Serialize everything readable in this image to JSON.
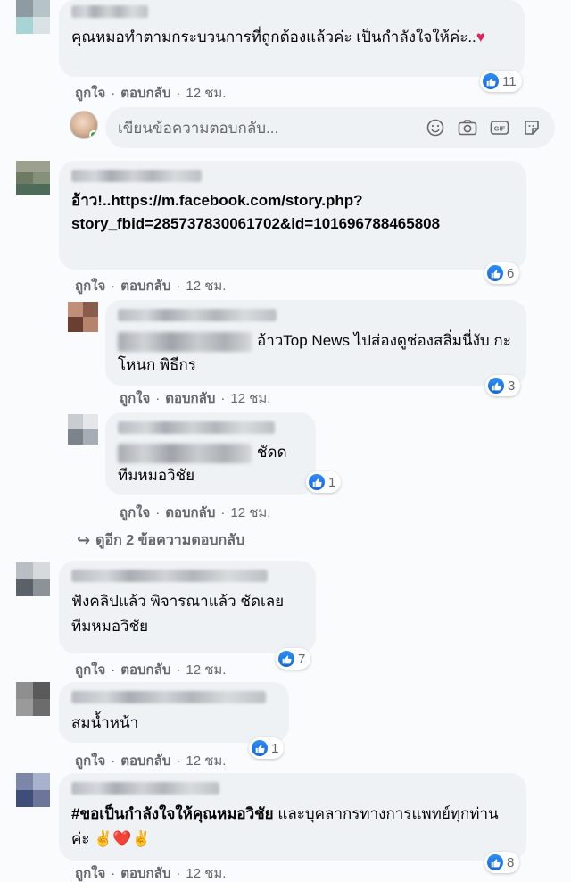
{
  "actions": {
    "like": "ถูกใจ",
    "reply": "ตอบกลับ",
    "separator": "·"
  },
  "reply_input": {
    "placeholder": "เขียนข้อความตอบกลับ..."
  },
  "view_more": {
    "label": "ดูอีก 2 ข้อความตอบกลับ"
  },
  "comments": [
    {
      "text": "คุณหมอทำตามกระบวนการที่ถูกต้องแล้วค่ะ เป็นกำลังใจให้ค่ะ..♥",
      "likes": "11",
      "time": "12 ชม."
    },
    {
      "text": "อ้าว!..https://m.facebook.com/story.php?story_fbid=285737830061702&id=101696788465808",
      "likes": "6",
      "time": "12 ชม."
    },
    {
      "text": "อ้าวTop News ไปส่องดูช่องสลิ่มนี่งับ กะโหนก พิธีกร",
      "likes": "3",
      "time": "12 ชม."
    },
    {
      "text_a": "ชัดด",
      "text_b": "ทีมหมอวิชัย",
      "likes": "1",
      "time": "12 ชม."
    },
    {
      "text_a": "ฟังคลิปแล้ว พิจารณาแล้ว ชัดเลย",
      "text_b": "ทีมหมอวิชัย",
      "likes": "7",
      "time": "12 ชม."
    },
    {
      "text": "สมน้ำหน้า",
      "likes": "1",
      "time": "12 ชม."
    },
    {
      "hashtag": "#ขอเป็นกำลังใจให้คุณหมอวิชัย",
      "text": " และบุคลากรทางการแพทย์ทุกท่านค่ะ ✌️❤️✌️",
      "likes": "8",
      "time": "12 ชม."
    }
  ]
}
